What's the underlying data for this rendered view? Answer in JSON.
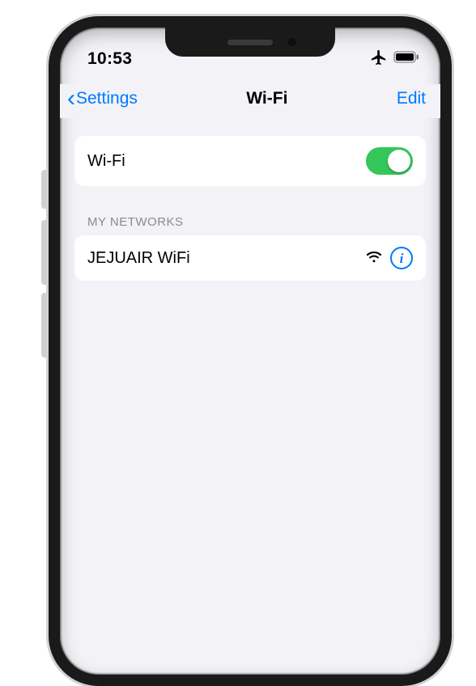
{
  "status": {
    "time": "10:53"
  },
  "nav": {
    "back": "Settings",
    "title": "Wi-Fi",
    "edit": "Edit"
  },
  "wifi": {
    "label": "Wi-Fi",
    "on": true
  },
  "sections": {
    "myNetworksHeader": "MY NETWORKS",
    "networks": [
      {
        "ssid": "JEJUAIR WiFi"
      }
    ]
  }
}
